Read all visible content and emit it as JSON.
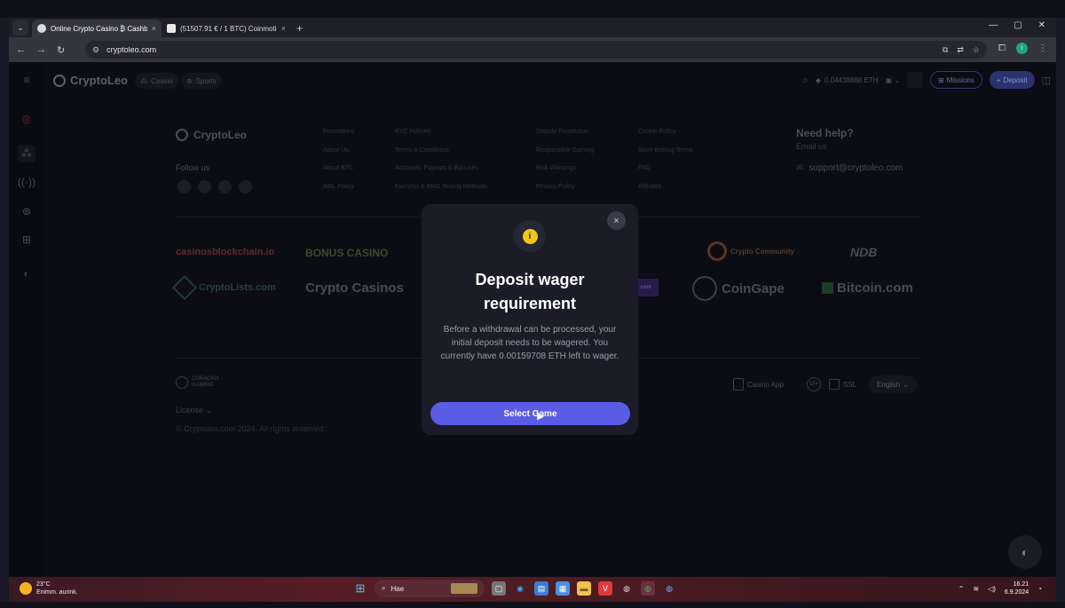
{
  "browser": {
    "tabs": [
      {
        "title": "Online Crypto Casino ₿ Cashba",
        "active": true
      },
      {
        "title": "(51507.91 € / 1 BTC) Coinmotio",
        "active": false
      }
    ],
    "url": "cryptoleo.com",
    "new_tab": "+",
    "tab_close": "×",
    "window_controls": [
      "—",
      "▢",
      "✕"
    ]
  },
  "header": {
    "logo": "CryptoLeo",
    "nav": [
      "Casino",
      "Sports"
    ],
    "balance": "0.04438888 ETH",
    "missions": "Missions",
    "deposit": "Deposit"
  },
  "footer": {
    "logo": "CryptoLeo",
    "follow_us": "Follow us",
    "col1": [
      "Promotions",
      "About Us",
      "About BTC",
      "AML Policy"
    ],
    "col2": [
      "KYC Policies",
      "Terms & Conditions",
      "Accounts, Payouts & Bonuses",
      "Fairness & RNG Testing Methods"
    ],
    "col3": [
      "Dispute Resolution",
      "Responsible Gaming",
      "Risk Warnings",
      "Privacy Policy"
    ],
    "col4": [
      "Cookie Policy",
      "Sport Betting Terms",
      "FAQ",
      "Affiliates"
    ],
    "help_title": "Need help?",
    "help_sub": "Email us",
    "help_email": "support@cryptoleo.com",
    "partners": {
      "casinosblockchain": "casinosblockchain.io",
      "bonuscasino": "BONUS CASINO",
      "cryptocommunity": "Crypto Community",
      "ndb": "NDB",
      "cryptolists": "CryptoLists.com",
      "cryptocasinos": "Crypto Casinos",
      "coingape": "CoinGape",
      "bitcoincom": "Bitcoin.com",
      "hidden_com": ".com"
    },
    "curacao": "CURACAO GAMING",
    "license": "License",
    "copyright": "© Cryptoleo.com 2024. All rights reserved.",
    "casino_app": "Casino App",
    "age": "18+",
    "ssl": "SSL",
    "language": "English"
  },
  "modal": {
    "icon": "i",
    "title": "Deposit wager\nrequirement",
    "body": "Before a withdrawal can be processed, your initial deposit needs to be wagered. You currently have 0.00159708 ETH left to wager.",
    "button": "Select Game",
    "close": "×"
  },
  "taskbar": {
    "temp": "23°C",
    "weather": "Enimm. aurink.",
    "search": "Hae",
    "time": "16.21",
    "date": "6.9.2024"
  },
  "colors": {
    "accent": "#5b5ce6",
    "modal_bg": "#1b1c27",
    "warning": "#f2c811"
  }
}
